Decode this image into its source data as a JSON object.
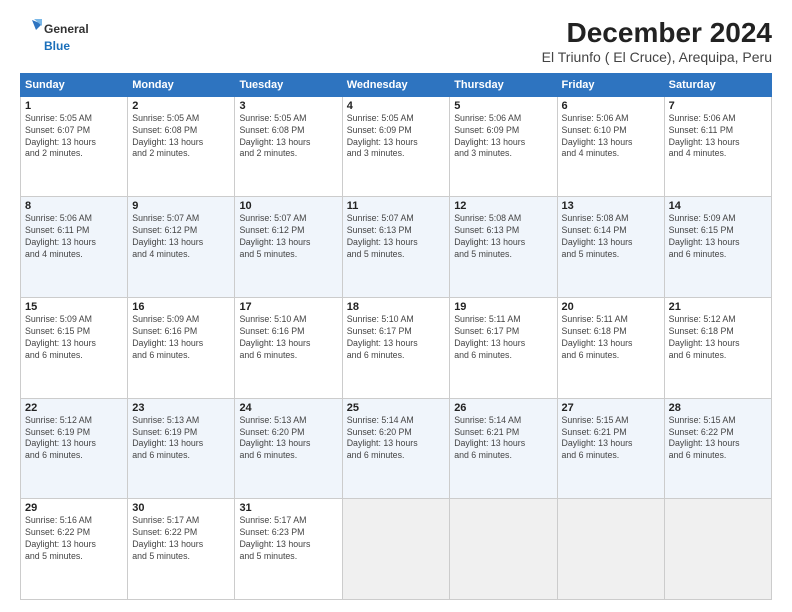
{
  "header": {
    "logo_line1": "General",
    "logo_line2": "Blue",
    "title": "December 2024",
    "subtitle": "El Triunfo ( El Cruce), Arequipa, Peru"
  },
  "calendar": {
    "headers": [
      "Sunday",
      "Monday",
      "Tuesday",
      "Wednesday",
      "Thursday",
      "Friday",
      "Saturday"
    ],
    "weeks": [
      [
        {
          "day": "",
          "info": ""
        },
        {
          "day": "2",
          "info": "Sunrise: 5:05 AM\nSunset: 6:08 PM\nDaylight: 13 hours\nand 2 minutes."
        },
        {
          "day": "3",
          "info": "Sunrise: 5:05 AM\nSunset: 6:08 PM\nDaylight: 13 hours\nand 2 minutes."
        },
        {
          "day": "4",
          "info": "Sunrise: 5:05 AM\nSunset: 6:09 PM\nDaylight: 13 hours\nand 3 minutes."
        },
        {
          "day": "5",
          "info": "Sunrise: 5:06 AM\nSunset: 6:09 PM\nDaylight: 13 hours\nand 3 minutes."
        },
        {
          "day": "6",
          "info": "Sunrise: 5:06 AM\nSunset: 6:10 PM\nDaylight: 13 hours\nand 4 minutes."
        },
        {
          "day": "7",
          "info": "Sunrise: 5:06 AM\nSunset: 6:11 PM\nDaylight: 13 hours\nand 4 minutes."
        }
      ],
      [
        {
          "day": "8",
          "info": "Sunrise: 5:06 AM\nSunset: 6:11 PM\nDaylight: 13 hours\nand 4 minutes."
        },
        {
          "day": "9",
          "info": "Sunrise: 5:07 AM\nSunset: 6:12 PM\nDaylight: 13 hours\nand 4 minutes."
        },
        {
          "day": "10",
          "info": "Sunrise: 5:07 AM\nSunset: 6:12 PM\nDaylight: 13 hours\nand 5 minutes."
        },
        {
          "day": "11",
          "info": "Sunrise: 5:07 AM\nSunset: 6:13 PM\nDaylight: 13 hours\nand 5 minutes."
        },
        {
          "day": "12",
          "info": "Sunrise: 5:08 AM\nSunset: 6:13 PM\nDaylight: 13 hours\nand 5 minutes."
        },
        {
          "day": "13",
          "info": "Sunrise: 5:08 AM\nSunset: 6:14 PM\nDaylight: 13 hours\nand 5 minutes."
        },
        {
          "day": "14",
          "info": "Sunrise: 5:09 AM\nSunset: 6:15 PM\nDaylight: 13 hours\nand 6 minutes."
        }
      ],
      [
        {
          "day": "15",
          "info": "Sunrise: 5:09 AM\nSunset: 6:15 PM\nDaylight: 13 hours\nand 6 minutes."
        },
        {
          "day": "16",
          "info": "Sunrise: 5:09 AM\nSunset: 6:16 PM\nDaylight: 13 hours\nand 6 minutes."
        },
        {
          "day": "17",
          "info": "Sunrise: 5:10 AM\nSunset: 6:16 PM\nDaylight: 13 hours\nand 6 minutes."
        },
        {
          "day": "18",
          "info": "Sunrise: 5:10 AM\nSunset: 6:17 PM\nDaylight: 13 hours\nand 6 minutes."
        },
        {
          "day": "19",
          "info": "Sunrise: 5:11 AM\nSunset: 6:17 PM\nDaylight: 13 hours\nand 6 minutes."
        },
        {
          "day": "20",
          "info": "Sunrise: 5:11 AM\nSunset: 6:18 PM\nDaylight: 13 hours\nand 6 minutes."
        },
        {
          "day": "21",
          "info": "Sunrise: 5:12 AM\nSunset: 6:18 PM\nDaylight: 13 hours\nand 6 minutes."
        }
      ],
      [
        {
          "day": "22",
          "info": "Sunrise: 5:12 AM\nSunset: 6:19 PM\nDaylight: 13 hours\nand 6 minutes."
        },
        {
          "day": "23",
          "info": "Sunrise: 5:13 AM\nSunset: 6:19 PM\nDaylight: 13 hours\nand 6 minutes."
        },
        {
          "day": "24",
          "info": "Sunrise: 5:13 AM\nSunset: 6:20 PM\nDaylight: 13 hours\nand 6 minutes."
        },
        {
          "day": "25",
          "info": "Sunrise: 5:14 AM\nSunset: 6:20 PM\nDaylight: 13 hours\nand 6 minutes."
        },
        {
          "day": "26",
          "info": "Sunrise: 5:14 AM\nSunset: 6:21 PM\nDaylight: 13 hours\nand 6 minutes."
        },
        {
          "day": "27",
          "info": "Sunrise: 5:15 AM\nSunset: 6:21 PM\nDaylight: 13 hours\nand 6 minutes."
        },
        {
          "day": "28",
          "info": "Sunrise: 5:15 AM\nSunset: 6:22 PM\nDaylight: 13 hours\nand 6 minutes."
        }
      ],
      [
        {
          "day": "29",
          "info": "Sunrise: 5:16 AM\nSunset: 6:22 PM\nDaylight: 13 hours\nand 5 minutes."
        },
        {
          "day": "30",
          "info": "Sunrise: 5:17 AM\nSunset: 6:22 PM\nDaylight: 13 hours\nand 5 minutes."
        },
        {
          "day": "31",
          "info": "Sunrise: 5:17 AM\nSunset: 6:23 PM\nDaylight: 13 hours\nand 5 minutes."
        },
        {
          "day": "",
          "info": ""
        },
        {
          "day": "",
          "info": ""
        },
        {
          "day": "",
          "info": ""
        },
        {
          "day": "",
          "info": ""
        }
      ]
    ],
    "week0_day1": {
      "day": "1",
      "info": "Sunrise: 5:05 AM\nSunset: 6:07 PM\nDaylight: 13 hours\nand 2 minutes."
    }
  }
}
